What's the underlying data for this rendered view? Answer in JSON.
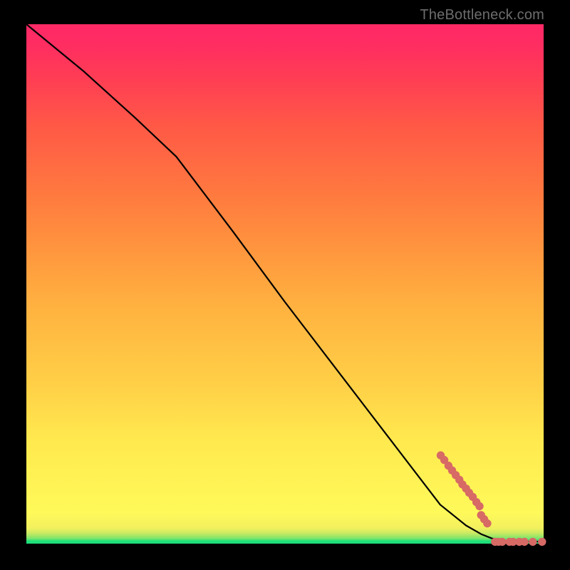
{
  "watermark": "TheBottleneck.com",
  "colors": {
    "dot": "#d76a65",
    "line": "#000000",
    "frame": "#000000"
  },
  "chart_data": {
    "type": "line",
    "title": "",
    "xlabel": "",
    "ylabel": "",
    "xlim": [
      0,
      100
    ],
    "ylim": [
      0,
      100
    ],
    "note": "Axes are unlabeled; x/y expressed as percent of inner plot area (0 = left/bottom, 100 = right/top). Values estimated from pixel positions.",
    "series": [
      {
        "name": "curve",
        "x": [
          0.0,
          11.0,
          21.0,
          29.0,
          40.0,
          50.0,
          60.0,
          70.0,
          80.0,
          85.0,
          88.0,
          90.0,
          92.0,
          94.0,
          96.0,
          98.0,
          100.0
        ],
        "y": [
          100.0,
          91.0,
          82.0,
          74.5,
          60.0,
          46.5,
          33.5,
          20.5,
          7.5,
          3.5,
          1.8,
          1.0,
          0.6,
          0.45,
          0.4,
          0.38,
          0.38
        ]
      }
    ],
    "scatter": {
      "name": "dots",
      "points_xy_pct": [
        [
          80.1,
          17.0
        ],
        [
          80.8,
          16.1
        ],
        [
          81.6,
          15.0
        ],
        [
          82.3,
          14.1
        ],
        [
          83.0,
          13.2
        ],
        [
          83.7,
          12.3
        ],
        [
          84.3,
          11.4
        ],
        [
          85.0,
          10.6
        ],
        [
          85.6,
          9.8
        ],
        [
          86.3,
          9.0
        ],
        [
          87.0,
          8.0
        ],
        [
          87.6,
          7.2
        ],
        [
          87.9,
          5.5
        ],
        [
          88.5,
          4.7
        ],
        [
          89.1,
          3.9
        ],
        [
          90.6,
          0.35
        ],
        [
          91.3,
          0.35
        ],
        [
          92.0,
          0.35
        ],
        [
          93.4,
          0.35
        ],
        [
          94.1,
          0.35
        ],
        [
          95.3,
          0.35
        ],
        [
          96.3,
          0.35
        ],
        [
          97.9,
          0.35
        ],
        [
          99.7,
          0.35
        ]
      ],
      "radius_px": 5.2
    }
  }
}
